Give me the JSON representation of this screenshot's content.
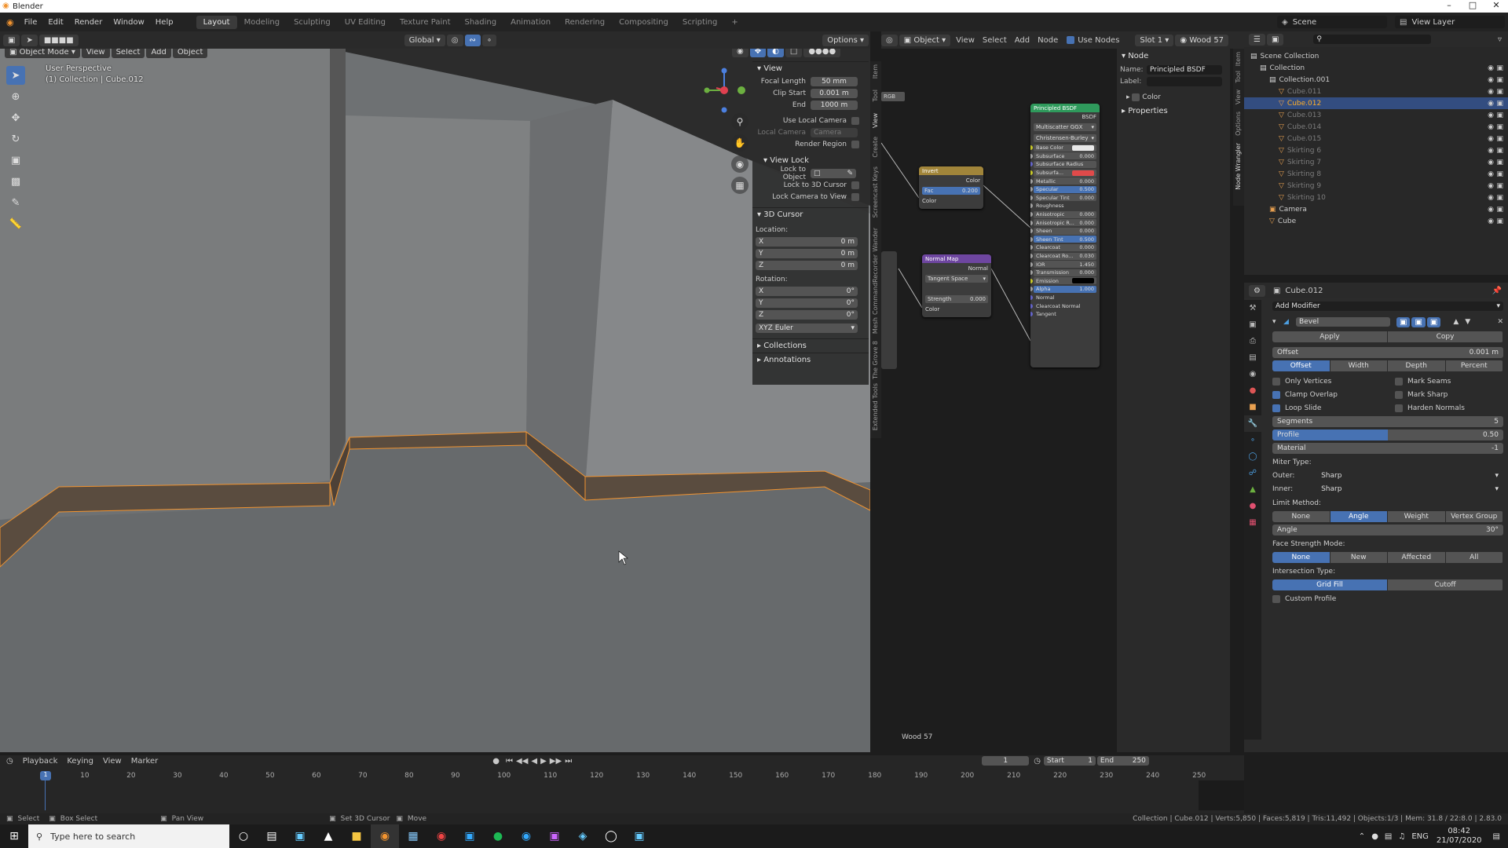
{
  "window": {
    "title": "Blender",
    "controls": [
      "–",
      "□",
      "✕"
    ]
  },
  "menu": {
    "items": [
      "File",
      "Edit",
      "Render",
      "Window",
      "Help"
    ],
    "workspaces": [
      "Layout",
      "Modeling",
      "Sculpting",
      "UV Editing",
      "Texture Paint",
      "Shading",
      "Animation",
      "Rendering",
      "Compositing",
      "Scripting"
    ],
    "add_workspace": "+",
    "scene": "Scene",
    "view_layer": "View Layer"
  },
  "viewport": {
    "mode": "Object Mode",
    "menus": [
      "View",
      "Select",
      "Add",
      "Object"
    ],
    "transform": "Global",
    "options": "Options",
    "overlay_title": "User Perspective",
    "overlay_sub": "(1) Collection | Cube.012"
  },
  "npanel": {
    "tabs": [
      "Item",
      "Tool",
      "View",
      "Create",
      "Screencast Keys",
      "Wander",
      "CommandRecorder",
      "Mesh",
      "The Grove 8",
      "Extended Tools"
    ],
    "view_header": "View",
    "focal_label": "Focal Length",
    "focal_value": "50 mm",
    "clip_start_label": "Clip Start",
    "clip_start_value": "0.001 m",
    "end_label": "End",
    "end_value": "1000 m",
    "use_local_camera": "Use Local Camera",
    "local_camera_label": "Local Camera",
    "local_camera_value": "Camera",
    "render_region": "Render Region",
    "view_lock": "View Lock",
    "lock_object": "Lock to Object",
    "lock_cursor": "Lock to 3D Cursor",
    "lock_camera": "Lock Camera to View",
    "cursor_header": "3D Cursor",
    "location": "Location:",
    "loc": [
      {
        "axis": "X",
        "val": "0 m"
      },
      {
        "axis": "Y",
        "val": "0 m"
      },
      {
        "axis": "Z",
        "val": "0 m"
      }
    ],
    "rotation": "Rotation:",
    "rot": [
      {
        "axis": "X",
        "val": "0°"
      },
      {
        "axis": "Y",
        "val": "0°"
      },
      {
        "axis": "Z",
        "val": "0°"
      }
    ],
    "euler": "XYZ Euler",
    "collections": "Collections",
    "annotations": "Annotations"
  },
  "node_editor": {
    "object": "Object",
    "menus": [
      "View",
      "Select",
      "Add",
      "Node"
    ],
    "use_nodes": "Use Nodes",
    "slot": "Slot 1",
    "material": "Wood 57",
    "footer_label": "Wood 57",
    "rgb": "RGB",
    "invert": {
      "title": "Invert",
      "out": "Color",
      "fac_label": "Fac",
      "fac_value": "0.200",
      "color": "Color"
    },
    "normal_map": {
      "title": "Normal Map",
      "out": "Normal",
      "space": "Tangent Space",
      "strength_label": "Strength",
      "strength_value": "0.000",
      "color": "Color"
    },
    "bsdf": {
      "title": "Principled BSDF",
      "out": "BSDF",
      "dist": "Multiscatter GGX",
      "sss": "Christensen-Burley",
      "rows": [
        {
          "label": "Base Color",
          "value": ""
        },
        {
          "label": "Subsurface",
          "value": "0.000"
        },
        {
          "label": "Subsurface Radius",
          "value": ""
        },
        {
          "label": "Subsurfa...",
          "value": ""
        },
        {
          "label": "Metallic",
          "value": "0.000"
        },
        {
          "label": "Specular",
          "value": "0.500"
        },
        {
          "label": "Specular Tint",
          "value": "0.000"
        },
        {
          "label": "Roughness",
          "value": ""
        },
        {
          "label": "Anisotropic",
          "value": "0.000"
        },
        {
          "label": "Anisotropic R...",
          "value": "0.000"
        },
        {
          "label": "Sheen",
          "value": "0.000"
        },
        {
          "label": "Sheen Tint",
          "value": "0.500"
        },
        {
          "label": "Clearcoat",
          "value": "0.000"
        },
        {
          "label": "Clearcoat Ro...",
          "value": "0.030"
        },
        {
          "label": "IOR",
          "value": "1.450"
        },
        {
          "label": "Transmission",
          "value": "0.000"
        },
        {
          "label": "Emission",
          "value": ""
        },
        {
          "label": "Alpha",
          "value": "1.000"
        },
        {
          "label": "Normal",
          "value": ""
        },
        {
          "label": "Clearcoat Normal",
          "value": ""
        },
        {
          "label": "Tangent",
          "value": ""
        }
      ]
    }
  },
  "node_sidebar": {
    "header": "Node",
    "name_label": "Name:",
    "name_value": "Principled BSDF",
    "label_label": "Label:",
    "color": "Color",
    "properties": "Properties",
    "tabs": [
      "Item",
      "Tool",
      "View",
      "Options",
      "Node Wrangler"
    ]
  },
  "outliner": {
    "rows": [
      {
        "name": "Scene Collection",
        "indent": 0,
        "sel": false,
        "dim": false
      },
      {
        "name": "Collection",
        "indent": 1,
        "sel": false,
        "dim": false
      },
      {
        "name": "Collection.001",
        "indent": 2,
        "sel": false,
        "dim": false
      },
      {
        "name": "Cube.011",
        "indent": 3,
        "sel": false,
        "dim": true
      },
      {
        "name": "Cube.012",
        "indent": 3,
        "sel": true,
        "dim": false
      },
      {
        "name": "Cube.013",
        "indent": 3,
        "sel": false,
        "dim": true
      },
      {
        "name": "Cube.014",
        "indent": 3,
        "sel": false,
        "dim": true
      },
      {
        "name": "Cube.015",
        "indent": 3,
        "sel": false,
        "dim": true
      },
      {
        "name": "Skirting 6",
        "indent": 3,
        "sel": false,
        "dim": true
      },
      {
        "name": "Skirting 7",
        "indent": 3,
        "sel": false,
        "dim": true
      },
      {
        "name": "Skirting 8",
        "indent": 3,
        "sel": false,
        "dim": true
      },
      {
        "name": "Skirting 9",
        "indent": 3,
        "sel": false,
        "dim": true
      },
      {
        "name": "Skirting 10",
        "indent": 3,
        "sel": false,
        "dim": true
      },
      {
        "name": "Camera",
        "indent": 2,
        "sel": false,
        "dim": false
      },
      {
        "name": "Cube",
        "indent": 2,
        "sel": false,
        "dim": false
      }
    ]
  },
  "properties": {
    "object": "Cube.012",
    "add_modifier": "Add Modifier",
    "modifier": "Bevel",
    "apply": "Apply",
    "copy": "Copy",
    "offset_label": "Offset",
    "offset_value": "0.001 m",
    "width_type": [
      "Offset",
      "Width",
      "Depth",
      "Percent"
    ],
    "only_vertices": "Only Vertices",
    "mark_seams": "Mark Seams",
    "clamp_overlap": "Clamp Overlap",
    "mark_sharp": "Mark Sharp",
    "loop_slide": "Loop Slide",
    "harden_normals": "Harden Normals",
    "segments_label": "Segments",
    "segments_value": "5",
    "profile_label": "Profile",
    "profile_value": "0.50",
    "profile_fill": 0.5,
    "material_label": "Material",
    "material_value": "-1",
    "miter": "Miter Type:",
    "outer_label": "Outer:",
    "outer_value": "Sharp",
    "inner_label": "Inner:",
    "inner_value": "Sharp",
    "limit": "Limit Method:",
    "limit_opts": [
      "None",
      "Angle",
      "Weight",
      "Vertex Group"
    ],
    "angle_label": "Angle",
    "angle_value": "30°",
    "face_strength": "Face Strength Mode:",
    "fs_opts": [
      "None",
      "New",
      "Affected",
      "All"
    ],
    "intersection": "Intersection Type:",
    "it_opts": [
      "Grid Fill",
      "Cutoff"
    ],
    "custom_profile": "Custom Profile"
  },
  "timeline": {
    "menus": [
      "Playback",
      "Keying",
      "View",
      "Marker"
    ],
    "current": "1",
    "start_label": "Start",
    "start_value": "1",
    "end_label": "End",
    "end_value": "250",
    "ticks": [
      10,
      20,
      30,
      40,
      50,
      60,
      70,
      80,
      90,
      100,
      110,
      120,
      130,
      140,
      150,
      160,
      170,
      180,
      190,
      200,
      210,
      220,
      230,
      240,
      250
    ]
  },
  "status": {
    "select": "Select",
    "box_select": "Box Select",
    "pan_view": "Pan View",
    "set_cursor": "Set 3D Cursor",
    "move": "Move",
    "info": "Collection | Cube.012 | Verts:5,850 | Faces:5,819 | Tris:11,492 | Objects:1/3 | Mem: 31.8 / 22:8.0 | 2.83.0"
  },
  "taskbar": {
    "search": "Type here to search",
    "lang": "ENG",
    "time": "08:42",
    "date": "21/07/2020"
  },
  "colors": {
    "accent": "#4772b3",
    "selection": "#f29430",
    "bg": "#1d1d1d"
  }
}
